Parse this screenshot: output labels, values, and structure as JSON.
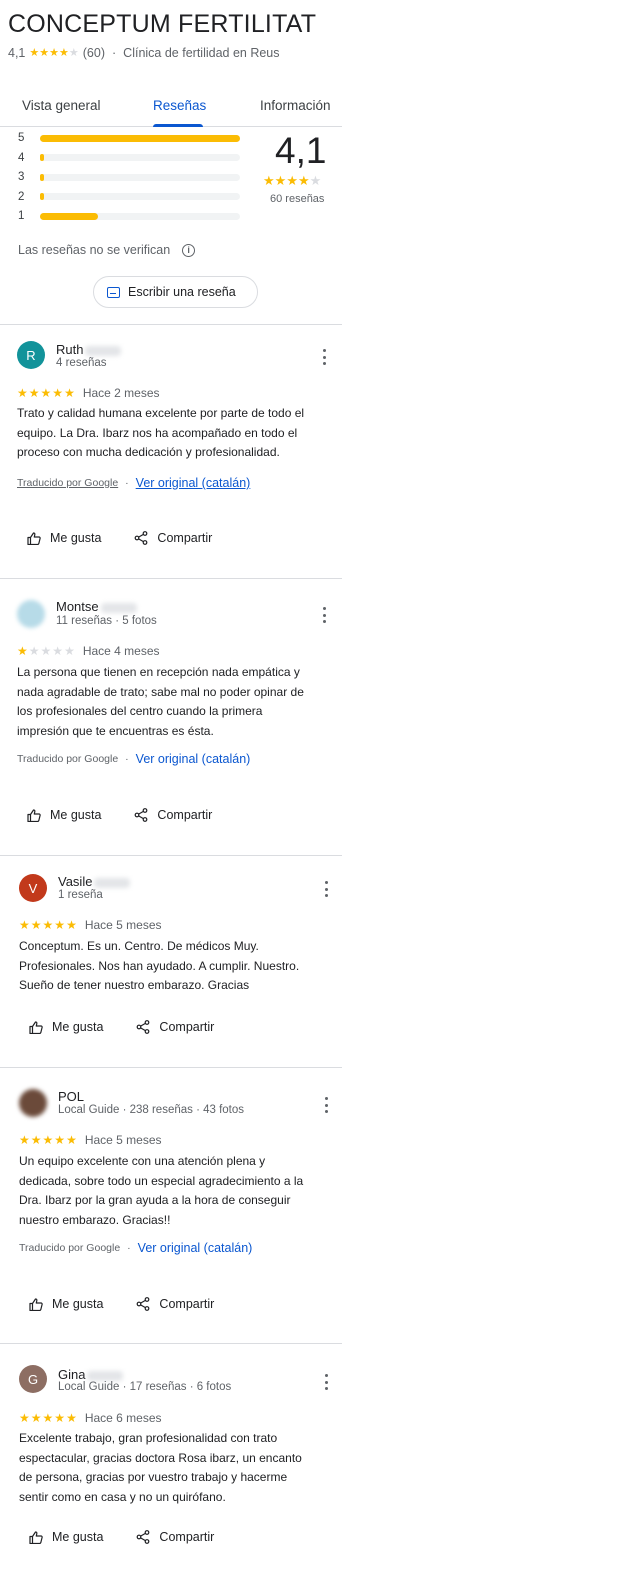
{
  "place": {
    "title": "CONCEPTUM FERTILITAT",
    "rating": "4,1",
    "rating_count": "(60)",
    "category": "Clínica de fertilidad en Reus"
  },
  "tabs": [
    "Vista general",
    "Reseñas",
    "Información"
  ],
  "active_tab": "Reseñas",
  "summary": {
    "big_rating": "4,1",
    "total": "60 reseñas",
    "distribution": [
      {
        "stars": "5",
        "fraction": 1.0
      },
      {
        "stars": "4",
        "fraction": 0.01
      },
      {
        "stars": "3",
        "fraction": 0.01
      },
      {
        "stars": "2",
        "fraction": 0.02
      },
      {
        "stars": "1",
        "fraction": 0.29
      }
    ]
  },
  "unverified_label": "Las reseñas no se verifican",
  "write_review_label": "Escribir una reseña",
  "action_labels": {
    "like": "Me gusta",
    "share": "Compartir"
  },
  "reviews": [
    {
      "name": "Ruth",
      "avatar_letter": "R",
      "avatar_color": "#12939a",
      "meta": "4 reseñas",
      "stars": 5,
      "when": "Hace 2 meses",
      "text": "Trato y calidad humana excelente por parte de todo el\nequipo. La Dra. Ibarz nos ha acompañado en todo el\nproceso con mucha dedicación y profesionalidad.",
      "translated_by": "Traducido por Google",
      "original_link": "Ver original (catalán)"
    },
    {
      "name": "Montse",
      "avatar_letter": "",
      "avatar_color": "#b7dbe8",
      "meta": "11 reseñas · 5 fotos",
      "stars": 1,
      "when": "Hace 4 meses",
      "text": "La persona que tienen en recepción nada empática y\nnada agradable de trato; sabe mal no poder opinar de\nlos profesionales del centro cuando la primera\nimpresión que te encuentras es ésta.",
      "translated_by": "Traducido por Google",
      "original_link": "Ver original (catalán)"
    },
    {
      "name": "Vasile",
      "avatar_letter": "V",
      "avatar_color": "#c2391b",
      "meta": "1 reseña",
      "stars": 5,
      "when": "Hace 5 meses",
      "text": "Conceptum. Es un. Centro. De médicos Muy.\nProfesionales.    Nos han ayudado. A cumplir. Nuestro.\nSueño  de tener nuestro embarazo.  Gracias",
      "translated_by": "",
      "original_link": ""
    },
    {
      "name": "POL",
      "avatar_letter": "",
      "avatar_color": "#6b4a3a",
      "meta": "Local Guide · 238 reseñas · 43 fotos",
      "stars": 5,
      "when": "Hace 5 meses",
      "text": "Un equipo excelente con una atención plena y\ndedicada, sobre todo un especial agradecimiento a la\nDra. Ibarz por la gran ayuda a la hora de conseguir\nnuestro embarazo. Gracias!!",
      "translated_by": "Traducido por Google",
      "original_link": "Ver original (catalán)"
    },
    {
      "name": "Gina",
      "avatar_letter": "G",
      "avatar_color": "#8d6e63",
      "meta": "Local Guide · 17 reseñas · 6 fotos",
      "stars": 5,
      "when": "Hace 6 meses",
      "text": "Excelente trabajo, gran profesionalidad con trato\nespectacular, gracias doctora  Rosa ibarz, un encanto\nde persona, gracias por vuestro trabajo y hacerme\nsentir como en casa  y no un quirófano.",
      "translated_by": "",
      "original_link": ""
    }
  ]
}
